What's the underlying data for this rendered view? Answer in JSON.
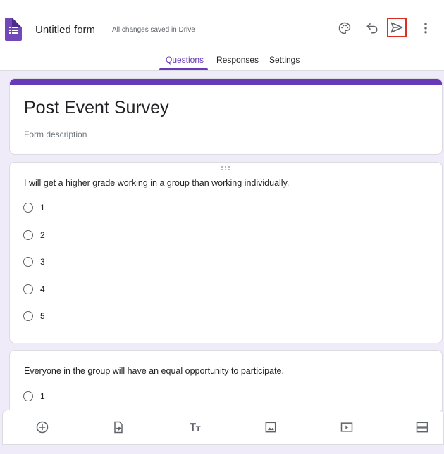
{
  "header": {
    "title": "Untitled form",
    "saved_status": "All changes saved in Drive",
    "tabs": [
      {
        "label": "Questions",
        "active": true
      },
      {
        "label": "Responses",
        "active": false
      },
      {
        "label": "Settings",
        "active": false
      }
    ],
    "icons": [
      "palette-icon",
      "undo-icon",
      "send-icon",
      "more-vert-icon"
    ],
    "accent_color": "#673ab7"
  },
  "form": {
    "title": "Post Event Survey",
    "description_placeholder": "Form description"
  },
  "questions": [
    {
      "text": "I will get a higher grade working in a group than working individually.",
      "options": [
        "1",
        "2",
        "3",
        "4",
        "5"
      ]
    },
    {
      "text": "Everyone in the group will have an equal opportunity to participate.",
      "options": [
        "1"
      ]
    }
  ],
  "toolbar": {
    "icons": [
      "add-question-icon",
      "import-questions-icon",
      "add-title-icon",
      "add-image-icon",
      "add-video-icon",
      "add-section-icon"
    ]
  }
}
